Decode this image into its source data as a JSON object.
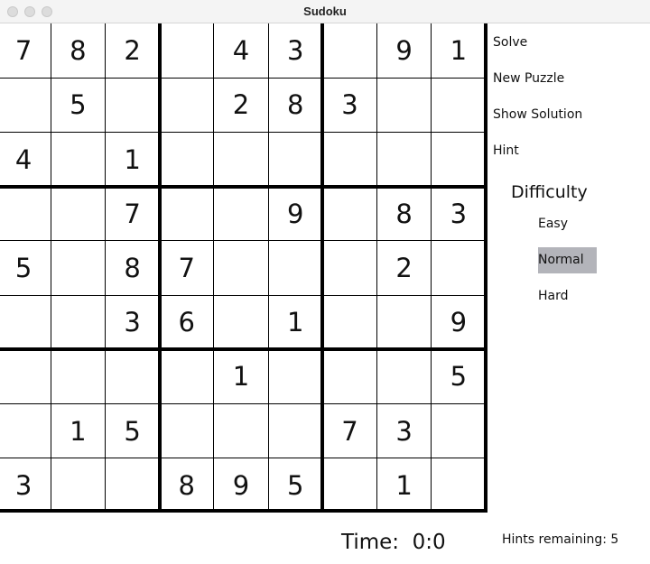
{
  "window": {
    "title": "Sudoku"
  },
  "board": {
    "rows": [
      [
        "7",
        "8",
        "2",
        "",
        "4",
        "3",
        "",
        "9",
        "1"
      ],
      [
        "",
        "5",
        "",
        "",
        "2",
        "8",
        "3",
        "",
        ""
      ],
      [
        "4",
        "",
        "1",
        "",
        "",
        "",
        "",
        "",
        ""
      ],
      [
        "",
        "",
        "7",
        "",
        "",
        "9",
        "",
        "8",
        "3"
      ],
      [
        "5",
        "",
        "8",
        "7",
        "",
        "",
        "",
        "2",
        ""
      ],
      [
        "",
        "",
        "3",
        "6",
        "",
        "1",
        "",
        "",
        "9"
      ],
      [
        "",
        "",
        "",
        "",
        "1",
        "",
        "",
        "",
        "5"
      ],
      [
        "",
        "1",
        "5",
        "",
        "",
        "",
        "7",
        "3",
        ""
      ],
      [
        "3",
        "",
        "",
        "8",
        "9",
        "5",
        "",
        "1",
        ""
      ]
    ]
  },
  "sidebar": {
    "solve_label": "Solve",
    "new_puzzle_label": "New Puzzle",
    "show_solution_label": "Show Solution",
    "hint_label": "Hint",
    "difficulty_title": "Difficulty",
    "difficulty_options": [
      {
        "label": "Easy",
        "selected": false
      },
      {
        "label": "Normal",
        "selected": true
      },
      {
        "label": "Hard",
        "selected": false
      }
    ]
  },
  "status": {
    "timer_label": "Time:",
    "timer_value": "0:0",
    "hints_remaining_label": "Hints remaining:",
    "hints_remaining_value": "5"
  }
}
